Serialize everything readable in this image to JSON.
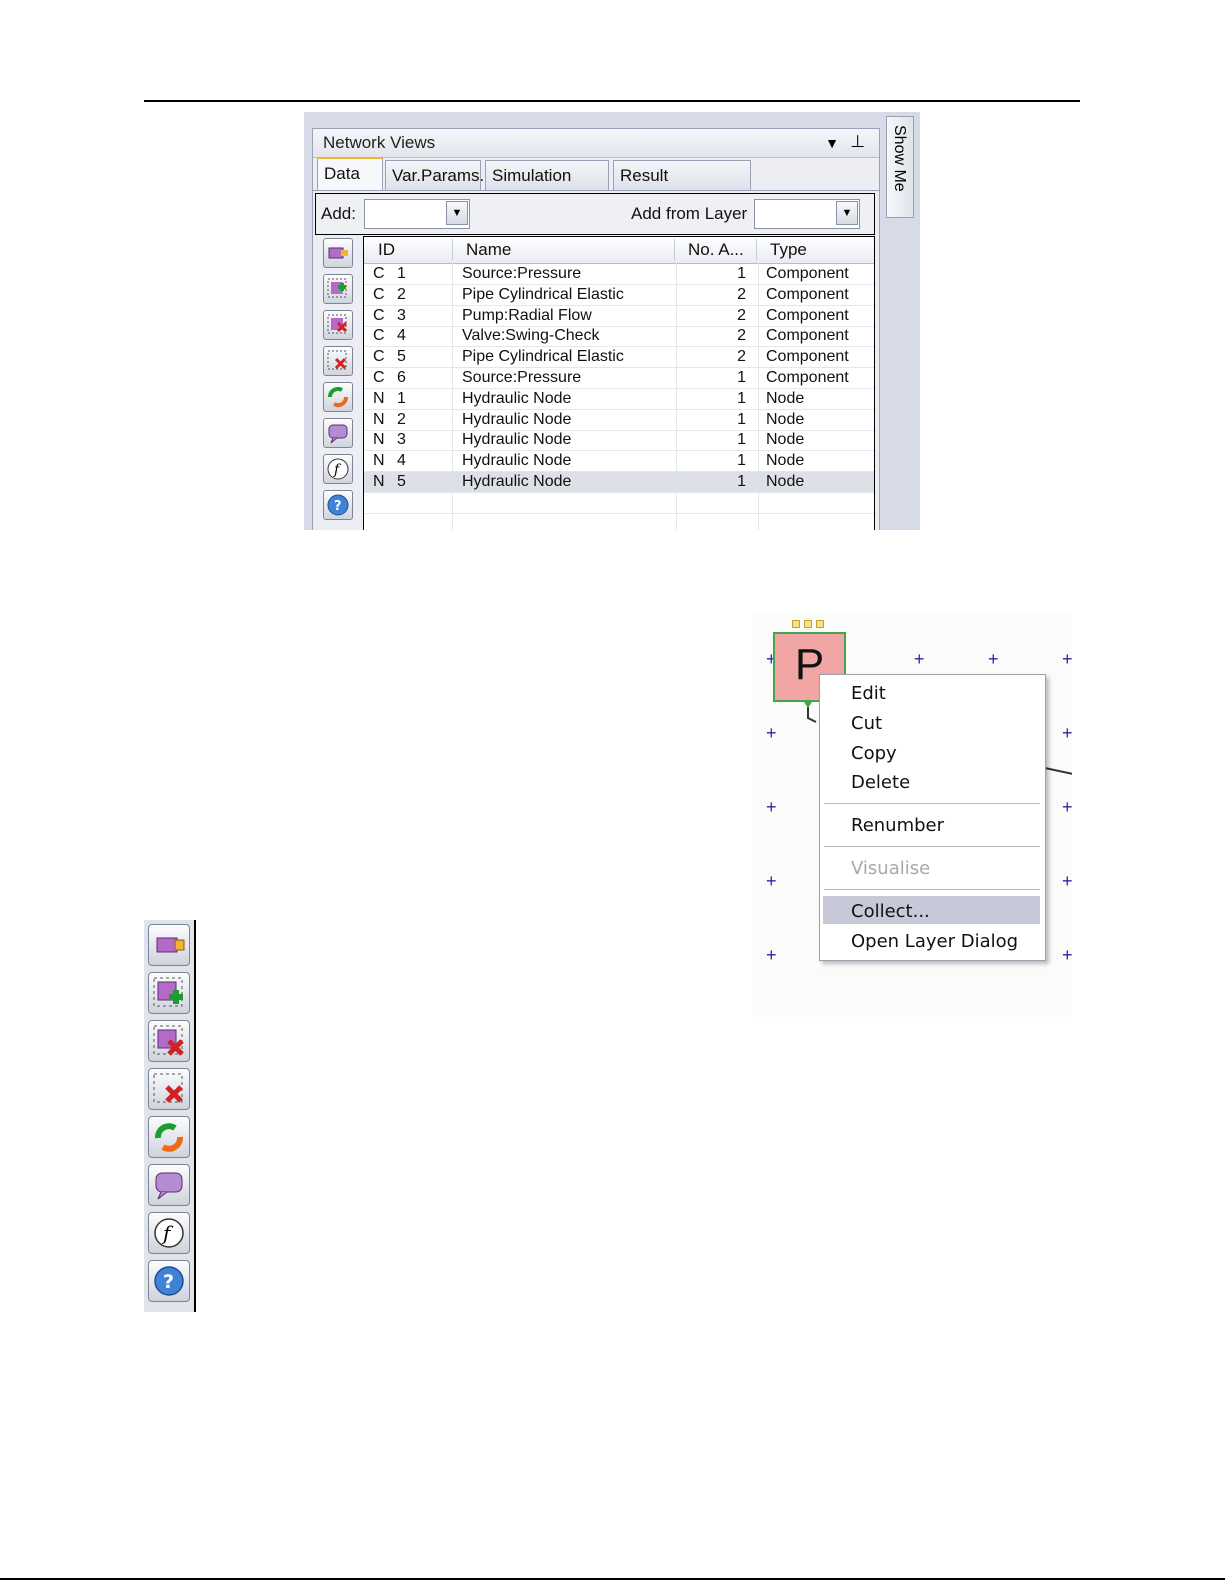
{
  "panel": {
    "title": "Network Views",
    "tabs": [
      "Data",
      "Var.Params.",
      "Simulation Data",
      "Result Sets/Audit"
    ],
    "add_label": "Add:",
    "add_from_layer_label": "Add from Layer",
    "show_me": "Show Me"
  },
  "grid": {
    "columns": [
      "ID",
      "Name",
      "No. A...",
      "Type"
    ],
    "rows": [
      {
        "p": "C",
        "n": "1",
        "name": "Source:Pressure",
        "no": "1",
        "type": "Component"
      },
      {
        "p": "C",
        "n": "2",
        "name": "Pipe Cylindrical Elastic",
        "no": "2",
        "type": "Component"
      },
      {
        "p": "C",
        "n": "3",
        "name": "Pump:Radial Flow",
        "no": "2",
        "type": "Component"
      },
      {
        "p": "C",
        "n": "4",
        "name": "Valve:Swing-Check",
        "no": "2",
        "type": "Component"
      },
      {
        "p": "C",
        "n": "5",
        "name": "Pipe Cylindrical Elastic",
        "no": "2",
        "type": "Component"
      },
      {
        "p": "C",
        "n": "6",
        "name": "Source:Pressure",
        "no": "1",
        "type": "Component"
      },
      {
        "p": "N",
        "n": "1",
        "name": "Hydraulic Node",
        "no": "1",
        "type": "Node"
      },
      {
        "p": "N",
        "n": "2",
        "name": "Hydraulic Node",
        "no": "1",
        "type": "Node"
      },
      {
        "p": "N",
        "n": "3",
        "name": "Hydraulic Node",
        "no": "1",
        "type": "Node"
      },
      {
        "p": "N",
        "n": "4",
        "name": "Hydraulic Node",
        "no": "1",
        "type": "Node"
      },
      {
        "p": "N",
        "n": "5",
        "name": "Hydraulic Node",
        "no": "1",
        "type": "Node"
      }
    ],
    "selected_row": 10
  },
  "canvas": {
    "component_letter": "P",
    "menu": {
      "edit": "Edit",
      "cut": "Cut",
      "copy": "Copy",
      "delete": "Delete",
      "renumber": "Renumber",
      "visualise": "Visualise",
      "collect": "Collect...",
      "open_layer_dialog": "Open Layer Dialog"
    }
  },
  "toolbar_icons": [
    "component-icon",
    "add-to-layer-icon",
    "remove-from-layer-icon",
    "delete-selection-icon",
    "refresh-icon",
    "comment-icon",
    "function-icon",
    "help-icon"
  ],
  "colors": {
    "component_fill": "#f1a5a5",
    "component_border": "#45a54a",
    "tab_accent": "#f2b233",
    "grid_plus": "#2727a6",
    "menu_highlight": "#c7c9d8"
  }
}
